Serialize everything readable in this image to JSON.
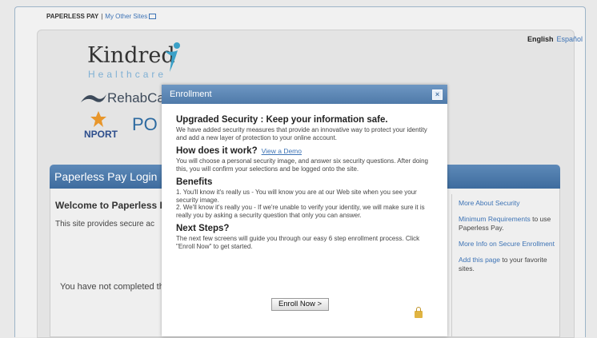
{
  "topbar": {
    "brand": "PAPERLESS PAY",
    "separator": "|",
    "other_sites": "My Other Sites"
  },
  "language": {
    "english": "English",
    "spanish": "Español"
  },
  "logos": {
    "kindred": "Kindred",
    "healthcare": "Healthcare",
    "rehab": "RehabCa",
    "po": "PO",
    "nport": "NPORT"
  },
  "login": {
    "title": "Paperless Pay Login",
    "welcome": "Welcome to Paperless F",
    "site_provides": "This site provides secure ac",
    "not_completed": "You have not completed th"
  },
  "sidebar": {
    "more_security": "More About Security",
    "min_req_link": "Minimum Requirements",
    "min_req_rest": " to use Paperless Pay.",
    "secure_enroll": "More Info on Secure Enrollment",
    "add_page_link": "Add this page",
    "add_page_rest": " to your favorite sites."
  },
  "modal": {
    "title": "Enrollment",
    "close": "×",
    "h1": "Upgraded Security : Keep your information safe.",
    "p1": "We have added security measures that provide an innovative way to protect your identity and add a new layer of protection to your online account.",
    "h2": "How does it work?",
    "demo_link": "View a Demo",
    "p2": "You will choose a personal security image, and answer six security questions. After doing this, you will confirm your selections and be logged onto the site.",
    "h3": "Benefits",
    "b1": "1. You'll know it's really us - You will know you are at our Web site when you see your security image.",
    "b2": "2. We'll know it's really you - If we're unable to verify your identity, we will make sure it is really you by asking a security question that only you can answer.",
    "h4": "Next Steps?",
    "p4": "The next few screens will guide you through our easy 6 step enrollment process. Click \"Enroll Now\" to get started.",
    "enroll_button": "Enroll Now >"
  }
}
